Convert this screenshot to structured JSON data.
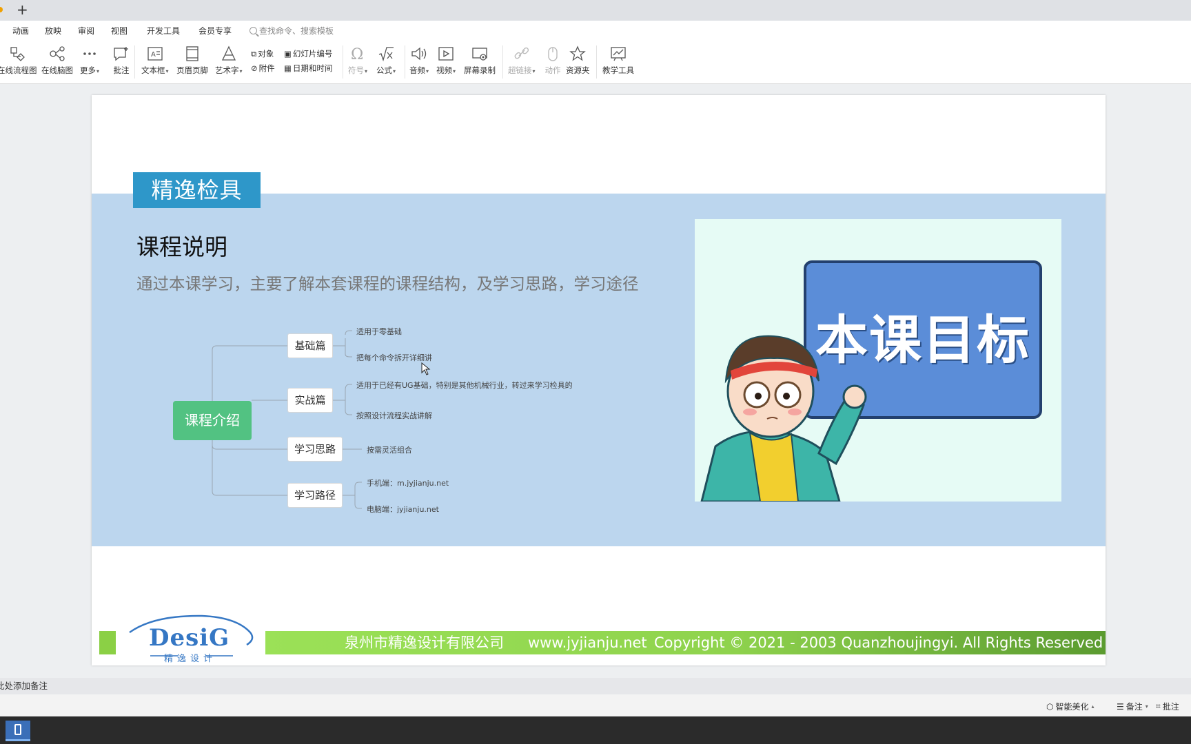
{
  "menu": {
    "items": [
      "动画",
      "放映",
      "审阅",
      "视图",
      "开发工具",
      "会员专享"
    ],
    "search_placeholder": "查找命令、搜索模板"
  },
  "toolbar": {
    "flowchart": "在线流程图",
    "mindmap": "在线脑图",
    "more": "更多",
    "comment": "批注",
    "textbox": "文本框",
    "header_footer": "页眉页脚",
    "wordart": "艺术字",
    "object": "对象",
    "slide_number": "幻灯片编号",
    "attachment": "附件",
    "datetime": "日期和时间",
    "symbol": "符号",
    "formula": "公式",
    "audio": "音频",
    "video": "视频",
    "screen_record": "屏幕录制",
    "hyperlink": "超链接",
    "action": "动作",
    "resources": "资源夹",
    "teaching_tools": "教学工具"
  },
  "slide": {
    "brand": "精逸检具",
    "title": "课程说明",
    "subtitle": "通过本课学习，主要了解本套课程的课程结构，及学习思路，学习途径",
    "mindmap": {
      "root": "课程介绍",
      "branches": [
        {
          "label": "基础篇",
          "leaves": [
            "适用于零基础",
            "把每个命令拆开详细讲"
          ]
        },
        {
          "label": "实战篇",
          "leaves": [
            "适用于已经有UG基础，特别是其他机械行业，转过来学习检具的",
            "按照设计流程实战讲解"
          ]
        },
        {
          "label": "学习思路",
          "leaves": [
            "按需灵活组合"
          ]
        },
        {
          "label": "学习路径",
          "leaves": [
            "手机端：m.jyjianju.net",
            "电脑端：jyjianju.net"
          ]
        }
      ]
    },
    "picture_text": "本课目标",
    "logo_text": "DesiG",
    "logo_sub": "精逸设计",
    "footer": {
      "company": "泉州市精逸设计有限公司",
      "website": "www.jyjianju.net",
      "copyright": "Copyright © 2021 - 2003 Quanzhoujingyi. All Rights Reserved"
    }
  },
  "notes_placeholder": "此处添加备注",
  "status": {
    "smart_beautify": "智能美化",
    "notes": "备注",
    "comments": "批注"
  },
  "colors": {
    "brand_blue": "#2e97c9",
    "band": "#bcd6ee",
    "mindmap_root": "#52c282",
    "footer_green": "#8fd34d"
  }
}
